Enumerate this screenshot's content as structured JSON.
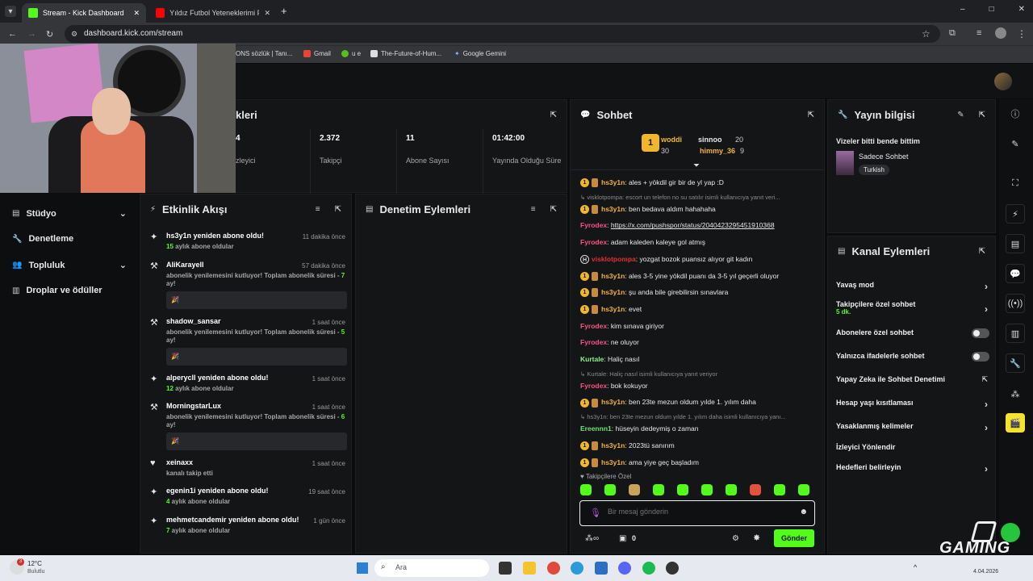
{
  "browser": {
    "tabs": [
      {
        "title": "Stream - Kick Dashboard",
        "active": true
      },
      {
        "title": "Yıldız Futbol Yeteneklerimi Puan",
        "active": false
      }
    ],
    "new_tab": "+",
    "url": "dashboard.kick.com/stream",
    "bookmarks": [
      "ONS sözlük | Tanı...",
      "Gmail",
      "u e",
      "The-Future-of-Hum...",
      "Google Gemini"
    ],
    "window_controls": [
      "–",
      "□",
      "✕"
    ]
  },
  "stats_panel": {
    "title": "kleri",
    "stats": [
      {
        "value": "4",
        "label": "zleyici"
      },
      {
        "value": "2.372",
        "label": "Takipçi"
      },
      {
        "value": "11",
        "label": "Abone Sayısı"
      },
      {
        "value": "01:42:00",
        "label": "Yayında Olduğu Süre"
      }
    ]
  },
  "sidebar": {
    "items": [
      {
        "label": "Stüdyo",
        "expandable": true
      },
      {
        "label": "Denetleme",
        "expandable": false
      },
      {
        "label": "Topluluk",
        "expandable": true
      },
      {
        "label": "Droplar ve ödüller",
        "expandable": false
      }
    ]
  },
  "activity": {
    "title": "Etkinlik Akışı",
    "items": [
      {
        "title": "hs3y1n yeniden abone oldu!",
        "time": "11 dakika önce",
        "sub_num": "15",
        "sub_text": " aylık abone oldular"
      },
      {
        "title": "AliKarayell",
        "time": "57 dakika önce",
        "desc": "abonelik yenilemesini kutluyor! Toplam abonelik süresi - ",
        "num": "7",
        "tail": " ay!",
        "box": "🎉"
      },
      {
        "title": "shadow_sansar",
        "time": "1 saat önce",
        "desc": "abonelik yenilemesini kutluyor! Toplam abonelik süresi - ",
        "num": "5",
        "tail": " ay!",
        "box": "🎉"
      },
      {
        "title": "alperycll yeniden abone oldu!",
        "time": "1 saat önce",
        "sub_num": "12",
        "sub_text": " aylık abone oldular"
      },
      {
        "title": "MorningstarLux",
        "time": "1 saat önce",
        "desc": "abonelik yenilemesini kutluyor! Toplam abonelik süresi - ",
        "num": "6",
        "tail": " ay!",
        "box": "🎉"
      },
      {
        "title": "xeinaxx",
        "time": "1 saat önce",
        "sub_text": "kanalı takip etti"
      },
      {
        "title": "egenin1i yeniden abone oldu!",
        "time": "19 saat önce",
        "sub_num": "4",
        "sub_text": " aylık abone oldular"
      },
      {
        "title": "mehmetcandemir yeniden abone oldu!",
        "time": "1 gün önce",
        "sub_num": "7",
        "sub_text": " aylık abone oldular"
      }
    ]
  },
  "moderation": {
    "title": "Denetim Eylemleri"
  },
  "chat": {
    "title": "Sohbet",
    "leaderboard": [
      {
        "name": "woddi",
        "count": "30"
      },
      {
        "name": "sinnoo",
        "count": "20"
      },
      {
        "name": "himmy_36",
        "count": "9"
      }
    ],
    "messages": [
      {
        "user": "hs3y1n",
        "color": "#f3b33d",
        "text": "ales + yökdil gir bir de yl yap :D",
        "badges": true
      },
      {
        "reply": "visklotpompa: escort un telefon no su satılır isimli kullanıcıya yanıt veri..."
      },
      {
        "user": "hs3y1n",
        "color": "#f3b33d",
        "text": "ben bedava aldım hahahaha",
        "badges": true
      },
      {
        "user": "Fyrodex",
        "color": "#ff4f86",
        "text": "https://x.com/pushspor/status/2040423295451910368",
        "link": true
      },
      {
        "user": "Fyrodex",
        "color": "#ff4f86",
        "text": "adam kaleden kaleye gol atmış"
      },
      {
        "user": "visklotpompa",
        "color": "#e0302e",
        "text": "yozgat bozok puansız alıyor git kadın",
        "hbadge": true
      },
      {
        "user": "hs3y1n",
        "color": "#f3b33d",
        "text": "ales 3-5 yine yökdil puanı da 3-5 yıl geçerli oluyor",
        "badges": true
      },
      {
        "user": "hs3y1n",
        "color": "#f3b33d",
        "text": "şu anda bile girebilirsin sınavlara",
        "badges": true
      },
      {
        "user": "hs3y1n",
        "color": "#f3b33d",
        "text": "evet",
        "badges": true
      },
      {
        "user": "Fyrodex",
        "color": "#ff4f86",
        "text": "kim sınava giriyor"
      },
      {
        "user": "Fyrodex",
        "color": "#ff4f86",
        "text": "ne oluyor"
      },
      {
        "user": "Kurtale",
        "color": "#8cf08c",
        "text": "Haliç nasıl"
      },
      {
        "reply": "Kurtale: Haliç nasıl isimli kullanıcıya yanıt veriyor"
      },
      {
        "user": "Fyrodex",
        "color": "#ff4f86",
        "text": "bok kokuyor"
      },
      {
        "user": "hs3y1n",
        "color": "#f3b33d",
        "text": "ben 23te mezun oldum yılde 1. yılım daha",
        "badges": true
      },
      {
        "reply": "hs3y1n: ben 23te mezun oldum yılde 1. yılım daha isimli kullanıcıya yanı..."
      },
      {
        "user": "Ereennn1",
        "color": "#6ce07b",
        "text": "hüseyin dedeymiş o zaman"
      },
      {
        "user": "hs3y1n",
        "color": "#f3b33d",
        "text": "2023tü sanırım",
        "badges": true
      },
      {
        "user": "hs3y1n",
        "color": "#f3b33d",
        "text": "ama yiye geç başladım",
        "badges": true
      }
    ],
    "followers_only": "Takipçilere Özel",
    "input_placeholder": "Bir mesaj gönderin",
    "points": "0",
    "send_label": "Gönder"
  },
  "stream_info": {
    "title": "Yayın bilgisi",
    "stream_title": "Vizeler bitti bende bittim",
    "category": "Sadece Sohbet",
    "language": "Turkish"
  },
  "channel_actions": {
    "title": "Kanal Eylemleri",
    "items": [
      {
        "label": "Yavaş mod",
        "type": "chevron"
      },
      {
        "label": "Takipçilere özel sohbet",
        "sub": "5 dk.",
        "type": "chevron"
      },
      {
        "label": "Abonelere özel sohbet",
        "type": "toggle"
      },
      {
        "label": "Yalnızca ifadelerle sohbet",
        "type": "toggle"
      },
      {
        "label": "Yapay Zeka ile Sohbet Denetimi",
        "type": "external"
      },
      {
        "label": "Hesap yaşı kısıtlaması",
        "type": "chevron"
      },
      {
        "label": "Yasaklanmış kelimeler",
        "type": "chevron"
      },
      {
        "label": "İzleyici Yönlendir",
        "type": "none"
      },
      {
        "label": "Hedefleri belirleyin",
        "type": "chevron"
      }
    ]
  },
  "taskbar": {
    "weather_temp": "12°C",
    "weather_desc": "Bulutlu",
    "search_placeholder": "Ara",
    "notification_count": "3",
    "clock_date": "4.04.2026"
  },
  "overlay": {
    "brand": "GAMING"
  },
  "colors": {
    "accent": "#53fc18",
    "panel": "#141517",
    "background": "#0b0c0e"
  }
}
